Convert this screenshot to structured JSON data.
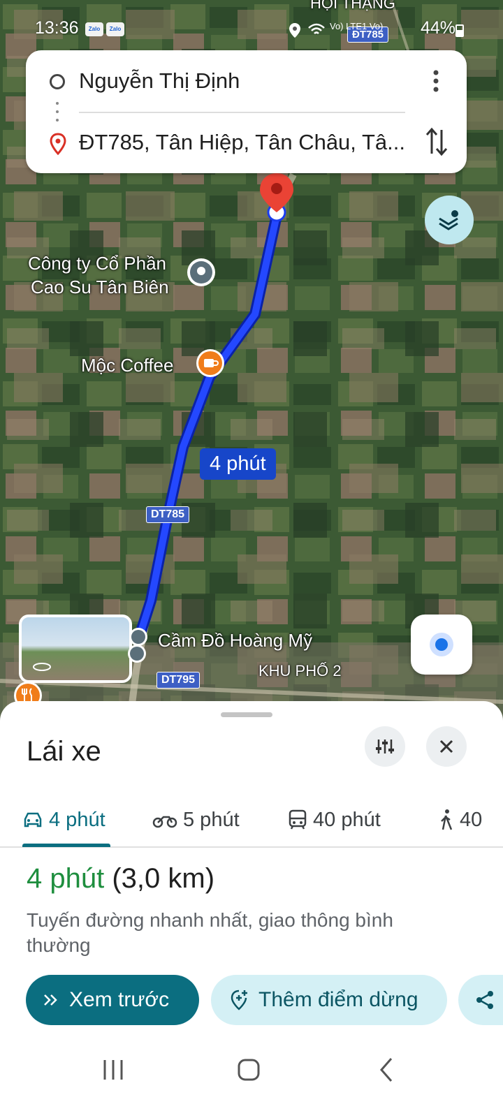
{
  "status_bar": {
    "time": "13:36",
    "apps": [
      "Zalo",
      "Zalo"
    ],
    "signal_text": "Vo) LTE1 Vo)",
    "battery": "44%"
  },
  "directions": {
    "origin": "Nguyễn Thị Định",
    "destination": "ĐT785, Tân Hiệp, Tân Châu, Tâ..."
  },
  "map": {
    "labels": {
      "poi_company_line1": "Công ty Cổ Phần",
      "poi_company_line2": "Cao Su Tân Biên",
      "poi_coffee": "Mộc Coffee",
      "poi_pawn": "Cầm Đồ Hoàng Mỹ",
      "area": "KHU PHỐ 2",
      "top_area": "HỘI THẠNG",
      "road_dt785_top": "ĐT785",
      "road_dt785": "DT785",
      "road_dt795": "DT795"
    },
    "eta_chip": "4 phút",
    "colors": {
      "route": "#1a3cf0",
      "destination_pin": "#ea4335"
    }
  },
  "sheet": {
    "title": "Lái xe",
    "tabs": [
      {
        "icon": "car-icon",
        "label": "4 phút",
        "active": true
      },
      {
        "icon": "motorbike-icon",
        "label": "5 phút"
      },
      {
        "icon": "transit-icon",
        "label": "40 phút"
      },
      {
        "icon": "walk-icon",
        "label": "40"
      }
    ],
    "summary_duration": "4 phút",
    "summary_distance": "(3,0 km)",
    "description": "Tuyến đường nhanh nhất, giao thông bình thường",
    "preview_button": "Xem trước",
    "add_stop_button": "Thêm điểm dừng",
    "accent": "#0b6e80"
  }
}
